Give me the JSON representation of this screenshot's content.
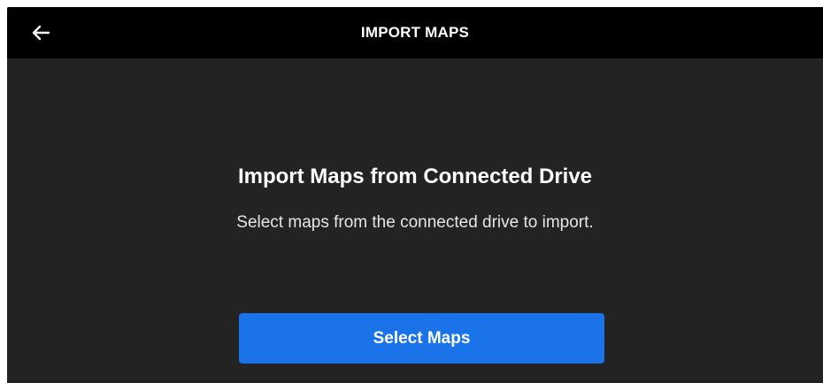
{
  "header": {
    "title": "IMPORT MAPS",
    "back_icon": "arrow-left-icon"
  },
  "main": {
    "heading": "Import Maps from Connected Drive",
    "description": "Select maps from the connected drive to import.",
    "primary_button_label": "Select Maps"
  },
  "colors": {
    "background": "#232323",
    "topbar": "#000000",
    "accent": "#1a73e8",
    "text": "#ffffff"
  }
}
